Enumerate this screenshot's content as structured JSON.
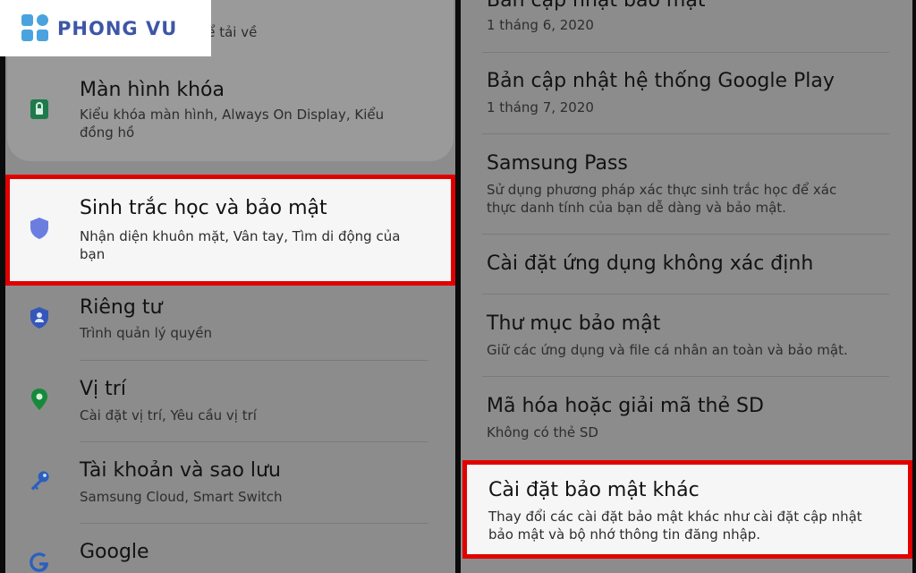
{
  "brand": {
    "name": "PHONG VU"
  },
  "colors": {
    "highlight": "#e00000",
    "shield": "#6b7ee0",
    "lock": "#1f7a4b",
    "privacy": "#3457b8",
    "location": "#168a3a",
    "key": "#2b5fbf"
  },
  "left": {
    "top_sub": "... biểu tượng có thể tải về",
    "items": [
      {
        "title": "Màn hình khóa",
        "sub": "Kiểu khóa màn hình, Always On Display, Kiểu đồng hồ",
        "icon": "lock-screen-icon"
      },
      {
        "title": "Sinh trắc học và bảo mật",
        "sub": "Nhận diện khuôn mặt, Vân tay, Tìm di động của bạn",
        "icon": "shield-icon"
      },
      {
        "title": "Riêng tư",
        "sub": "Trình quản lý quyền",
        "icon": "privacy-icon"
      },
      {
        "title": "Vị trí",
        "sub": "Cài đặt vị trí, Yêu cầu vị trí",
        "icon": "location-pin-icon"
      },
      {
        "title": "Tài khoản và sao lưu",
        "sub": "Samsung Cloud, Smart Switch",
        "icon": "key-icon"
      },
      {
        "title": "Google",
        "sub": "",
        "icon": "google-icon"
      }
    ]
  },
  "right": {
    "items": [
      {
        "title": "Bản cập nhật bảo mật",
        "sub": "1 tháng 6, 2020"
      },
      {
        "title": "Bản cập nhật hệ thống Google Play",
        "sub": "1 tháng 7, 2020"
      },
      {
        "title": "Samsung Pass",
        "sub": "Sử dụng phương pháp xác thực sinh trắc học để xác thực danh tính của bạn dễ dàng và bảo mật."
      },
      {
        "title": "Cài đặt ứng dụng không xác định",
        "sub": ""
      },
      {
        "title": "Thư mục bảo mật",
        "sub": "Giữ các ứng dụng và file cá nhân an toàn và bảo mật."
      },
      {
        "title": "Mã hóa hoặc giải mã thẻ SD",
        "sub": "Không có thẻ SD"
      },
      {
        "title": "Cài đặt bảo mật khác",
        "sub": "Thay đổi các cài đặt bảo mật khác như cài đặt cập nhật bảo mật và bộ nhớ thông tin đăng nhập."
      }
    ]
  }
}
